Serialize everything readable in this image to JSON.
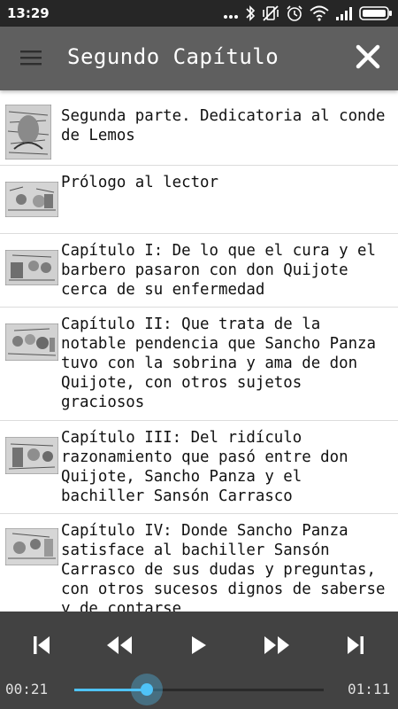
{
  "status_bar": {
    "time": "13:29",
    "icons": [
      "more-dots-icon",
      "bluetooth-icon",
      "vibrate-off-icon",
      "alarm-icon",
      "wifi-icon",
      "signal-icon",
      "battery-icon"
    ]
  },
  "app_bar": {
    "title": "Segundo Capítulo",
    "menu_icon": "hamburger-menu-icon",
    "close_icon": "close-icon"
  },
  "chapters": [
    {
      "label": "Segunda parte. Dedicatoria al conde de Lemos",
      "thumbnail": "engraving-portrait-thumbnail"
    },
    {
      "label": "Prólogo al lector",
      "thumbnail": "engraving-scene-thumbnail"
    },
    {
      "label": "Capítulo I: De lo que el cura y el barbero pasaron con don Quijote cerca de su enfermedad",
      "thumbnail": "engraving-scene-thumbnail"
    },
    {
      "label": "Capítulo II: Que trata de la notable pendencia que Sancho Panza tuvo con la sobrina y ama de don Quijote, con otros sujetos graciosos",
      "thumbnail": "engraving-scene-thumbnail"
    },
    {
      "label": "Capítulo III: Del ridículo razonamiento que pasó entre don Quijote, Sancho Panza y el bachiller Sansón Carrasco",
      "thumbnail": "engraving-scene-thumbnail"
    },
    {
      "label": "Capítulo IV: Donde Sancho Panza satisface al bachiller Sansón Carrasco de sus dudas y preguntas, con otros sucesos dignos de saberse y de contarse",
      "thumbnail": "engraving-scene-thumbnail"
    }
  ],
  "player": {
    "elapsed": "00:21",
    "duration": "01:11",
    "progress_fraction": 0.29,
    "accent_color": "#4fc3f7",
    "controls": [
      "skip-previous-icon",
      "rewind-icon",
      "play-icon",
      "fast-forward-icon",
      "skip-next-icon"
    ]
  }
}
